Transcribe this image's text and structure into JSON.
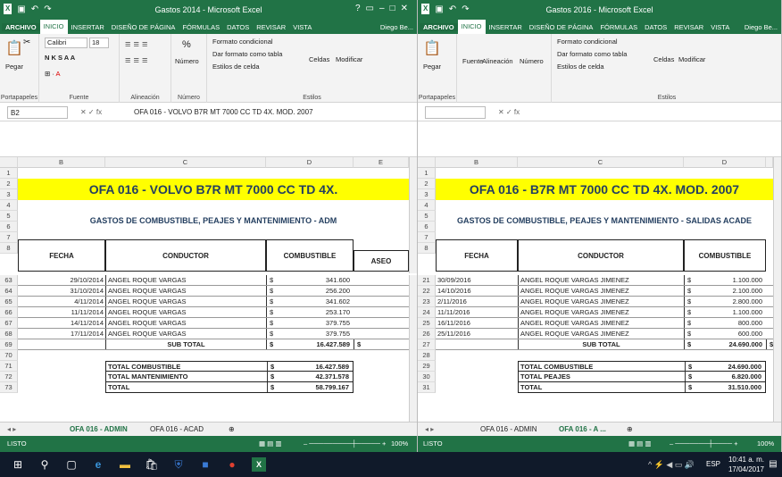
{
  "left": {
    "title": "Gastos 2014 - Microsoft Excel",
    "tabs": [
      "ARCHIVO",
      "INICIO",
      "INSERTAR",
      "DISEÑO DE PÁGINA",
      "FÓRMULAS",
      "DATOS",
      "REVISAR",
      "VISTA"
    ],
    "user": "Diego Be...",
    "font_name": "Calibri",
    "font_size": "18",
    "groups": [
      "Portapapeles",
      "Fuente",
      "Alineación",
      "Número",
      "Estilos"
    ],
    "paste": "Pegar",
    "number": "Número",
    "styles": [
      "Formato condicional",
      "Dar formato como tabla",
      "Estilos de celda"
    ],
    "cells": "Celdas",
    "modify": "Modificar",
    "namebox": "B2",
    "formula": "OFA 016  -  VOLVO B7R MT 7000 CC TD 4X. MOD. 2007",
    "cols": [
      "B",
      "C",
      "D",
      "E"
    ],
    "banner": "OFA 016  -  VOLVO B7R MT 7000 CC TD 4X.",
    "subtitle": "GASTOS DE COMBUSTIBLE, PEAJES Y MANTENIMIENTO - ADM",
    "headers": [
      "FECHA",
      "CONDUCTOR",
      "COMBUSTIBLE",
      "ASEO"
    ],
    "top_rows": [
      "1",
      "2",
      "3",
      "4",
      "5",
      "6",
      "7",
      "8"
    ],
    "data_rows": [
      {
        "row": "63",
        "date": "29/10/2014",
        "driver": "ANGEL ROQUE VARGAS",
        "amount": "341.600"
      },
      {
        "row": "64",
        "date": "31/10/2014",
        "driver": "ANGEL ROQUE VARGAS",
        "amount": "256.200"
      },
      {
        "row": "65",
        "date": "4/11/2014",
        "driver": "ANGEL ROQUE VARGAS",
        "amount": "341.602"
      },
      {
        "row": "66",
        "date": "11/11/2014",
        "driver": "ANGEL ROQUE VARGAS",
        "amount": "253.170"
      },
      {
        "row": "67",
        "date": "14/11/2014",
        "driver": "ANGEL ROQUE VARGAS",
        "amount": "379.755"
      },
      {
        "row": "68",
        "date": "17/11/2014",
        "driver": "ANGEL ROQUE VARGAS",
        "amount": "379.755"
      }
    ],
    "subtotal": {
      "row": "69",
      "label": "SUB TOTAL",
      "amount": "16.427.589"
    },
    "blank_row": "70",
    "totals": [
      {
        "row": "71",
        "label": "TOTAL COMBUSTIBLE",
        "amount": "16.427.589"
      },
      {
        "row": "72",
        "label": "TOTAL MANTENIMIENTO",
        "amount": "42.371.578"
      },
      {
        "row": "73",
        "label": "TOTAL",
        "amount": "58.799.167"
      }
    ],
    "sheets": [
      "OFA 016 - ADMIN",
      "OFA 016 - ACAD"
    ],
    "status": "LISTO",
    "zoom": "100%"
  },
  "right": {
    "title": "Gastos 2016 - Microsoft Excel",
    "tabs": [
      "ARCHIVO",
      "INICIO",
      "INSERTAR",
      "DISEÑO DE PÁGINA",
      "FÓRMULAS",
      "DATOS",
      "REVISAR",
      "VISTA"
    ],
    "user": "Diego Be...",
    "groups": [
      "Portapapeles",
      "Fuente",
      "Alineación",
      "Número",
      "Estilos"
    ],
    "paste": "Pegar",
    "font": "Fuente",
    "align": "Alineación",
    "number": "Número",
    "styles": [
      "Formato condicional",
      "Dar formato como tabla",
      "Estilos de celda"
    ],
    "cells": "Celdas",
    "modify": "Modificar",
    "cols": [
      "B",
      "C",
      "D"
    ],
    "banner": "OFA 016  -  B7R MT 7000 CC TD 4X. MOD. 2007",
    "subtitle": "GASTOS DE COMBUSTIBLE, PEAJES Y MANTENIMIENTO - SALIDAS ACADE",
    "headers": [
      "FECHA",
      "CONDUCTOR",
      "COMBUSTIBLE"
    ],
    "top_rows": [
      "1",
      "2",
      "3",
      "4",
      "5",
      "6",
      "7",
      "8"
    ],
    "data_rows": [
      {
        "row": "21",
        "date": "30/09/2016",
        "driver": "ANGEL ROQUE VARGAS JIMENEZ",
        "amount": "1.100.000"
      },
      {
        "row": "22",
        "date": "14/10/2016",
        "driver": "ANGEL ROQUE VARGAS JIMENEZ",
        "amount": "2.100.000"
      },
      {
        "row": "23",
        "date": "2/11/2016",
        "driver": "ANGEL ROQUE VARGAS JIMENEZ",
        "amount": "2.800.000"
      },
      {
        "row": "24",
        "date": "11/11/2016",
        "driver": "ANGEL ROQUE VARGAS JIMENEZ",
        "amount": "1.100.000"
      },
      {
        "row": "25",
        "date": "16/11/2016",
        "driver": "ANGEL ROQUE VARGAS JIMENEZ",
        "amount": "800.000"
      },
      {
        "row": "26",
        "date": "25/11/2016",
        "driver": "ANGEL ROQUE VARGAS JIMENEZ",
        "amount": "600.000"
      }
    ],
    "subtotal": {
      "row": "27",
      "label": "SUB TOTAL",
      "amount": "24.690.000"
    },
    "blank_row": "28",
    "totals": [
      {
        "row": "29",
        "label": "TOTAL COMBUSTIBLE",
        "amount": "24.690.000"
      },
      {
        "row": "30",
        "label": "TOTAL PEAJES",
        "amount": "6.820.000"
      },
      {
        "row": "31",
        "label": "TOTAL",
        "amount": "31.510.000"
      }
    ],
    "sheets": [
      "OFA 016 - ADMIN",
      "OFA 016 - A ..."
    ],
    "status": "LISTO",
    "zoom": "100%"
  },
  "currency": "$",
  "taskbar": {
    "time": "10:41 a. m.",
    "date": "17/04/2017",
    "lang": "ESP"
  }
}
